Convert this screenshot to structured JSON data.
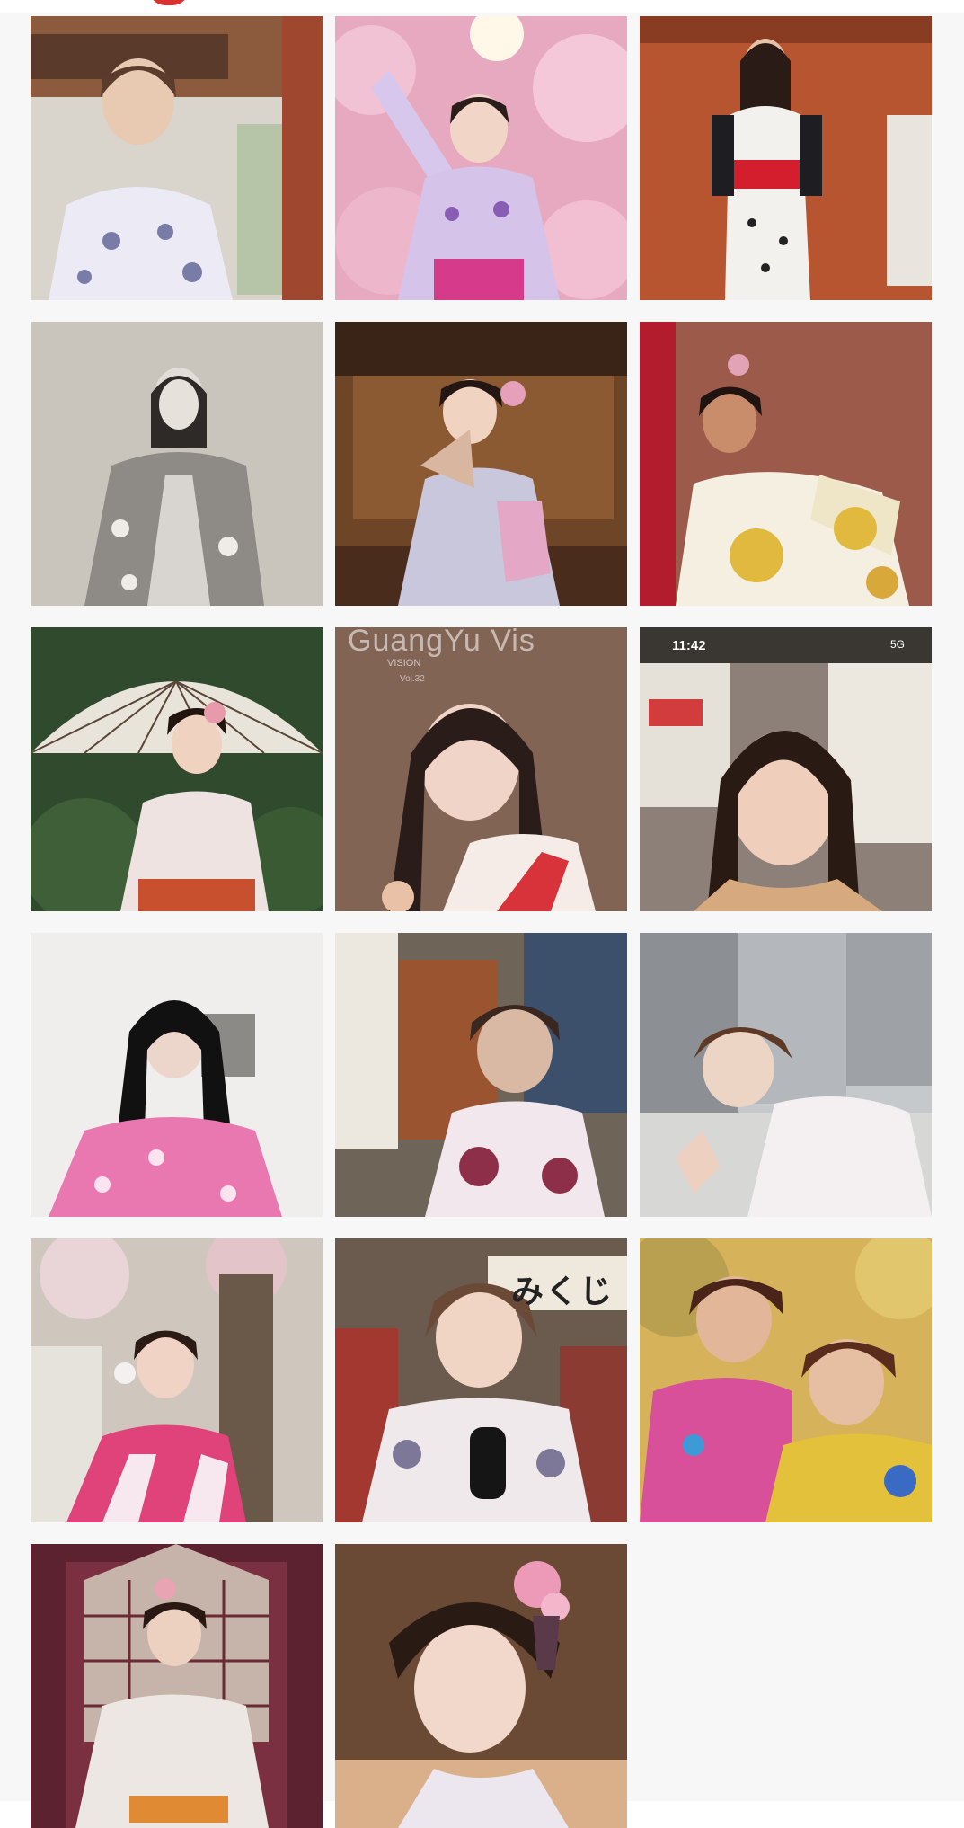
{
  "photos": [
    {
      "id": 1,
      "subject": "woman-white-yukata-temple"
    },
    {
      "id": 2,
      "subject": "woman-cherry-blossoms-purple-kimono"
    },
    {
      "id": 3,
      "subject": "woman-black-white-yukata-red-obi"
    },
    {
      "id": 4,
      "subject": "woman-vintage-bw-kimono"
    },
    {
      "id": 5,
      "subject": "woman-folding-fan-lilac-kimono"
    },
    {
      "id": 6,
      "subject": "woman-gold-patterned-kimono"
    },
    {
      "id": 7,
      "subject": "woman-paper-umbrella-kimono"
    },
    {
      "id": 8,
      "subject": "woman-red-white-kimono-closeup",
      "watermark": "GuangYu Vis",
      "watermark_sub": "VISION",
      "watermark_small": "Vol.32"
    },
    {
      "id": 9,
      "subject": "woman-phone-screenshot",
      "status_time": "11:42",
      "status_network": "5G"
    },
    {
      "id": 10,
      "subject": "woman-pink-floral-kimono-long-hair"
    },
    {
      "id": 11,
      "subject": "woman-floral-yukata-street-poster"
    },
    {
      "id": 12,
      "subject": "woman-peace-sign-street"
    },
    {
      "id": 13,
      "subject": "woman-pink-kimono-blossom-tree"
    },
    {
      "id": 14,
      "subject": "woman-floral-kimono-interview-mic",
      "sign_text": "みくじ"
    },
    {
      "id": 15,
      "subject": "two-women-colorful-yukata"
    },
    {
      "id": 16,
      "subject": "woman-pale-kimono-doorway"
    },
    {
      "id": 17,
      "subject": "woman-hair-flower-smile-closeup"
    }
  ],
  "colors": {
    "page_background": "#f7f7f7",
    "logo_accent": "#d6322f"
  }
}
